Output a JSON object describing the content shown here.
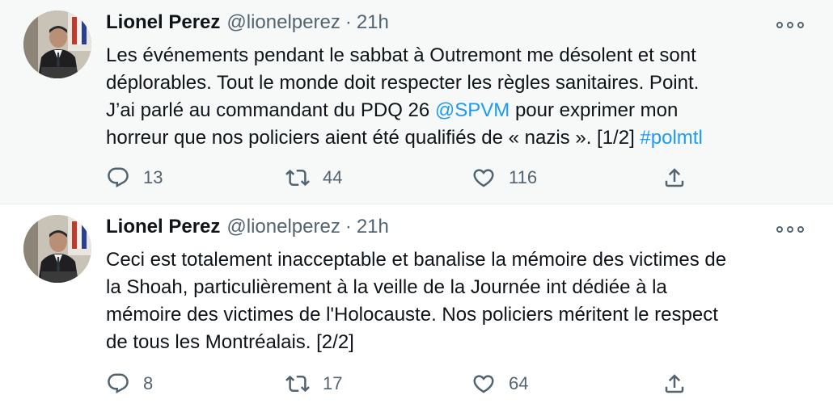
{
  "tweets": [
    {
      "author_name": "Lionel Perez",
      "handle": "@lionelperez",
      "separator": "·",
      "time": "21h",
      "text_lines": [
        [
          {
            "t": "Les événements pendant le sabbat à Outremont me désolent et sont"
          }
        ],
        [
          {
            "t": "déplorables. Tout le monde doit respecter les règles sanitaires. Point."
          }
        ],
        [
          {
            "t": "J’ai parlé au commandant du PDQ 26 "
          },
          {
            "t": "@SPVM",
            "link": true
          },
          {
            "t": " pour exprimer mon"
          }
        ],
        [
          {
            "t": "horreur que nos policiers aient été qualifiés de « nazis ». [1/2] "
          },
          {
            "t": "#polmtl",
            "link": true
          }
        ]
      ],
      "replies": "13",
      "retweets": "44",
      "likes": "116"
    },
    {
      "author_name": "Lionel Perez",
      "handle": "@lionelperez",
      "separator": "·",
      "time": "21h",
      "text_lines": [
        [
          {
            "t": "Ceci est totalement inacceptable et banalise la mémoire des victimes de"
          }
        ],
        [
          {
            "t": "la Shoah, particulièrement à la veille de la Journée int dédiée à la"
          }
        ],
        [
          {
            "t": "mémoire des victimes de l'Holocauste. Nos policiers méritent le respect"
          }
        ],
        [
          {
            "t": "de tous les Montréalais.  [2/2]"
          }
        ]
      ],
      "replies": "8",
      "retweets": "17",
      "likes": "64"
    }
  ],
  "icons": {
    "reply": "reply-icon",
    "retweet": "retweet-icon",
    "like": "heart-icon",
    "share": "share-icon",
    "more": "more-icon"
  },
  "colors": {
    "link": "#1d9bf0",
    "secondary_text": "#536471",
    "highlight_bg": "#f7f9f9"
  }
}
